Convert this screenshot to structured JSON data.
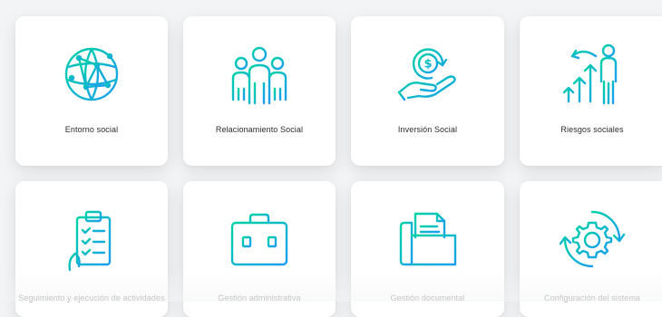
{
  "modules": [
    {
      "id": "entorno",
      "label": "Entorno social",
      "icon": "globe-network-icon"
    },
    {
      "id": "relacionamiento",
      "label": "Relacionamiento Social",
      "icon": "people-group-icon"
    },
    {
      "id": "inversion",
      "label": "Inversión Social",
      "icon": "hand-coin-icon"
    },
    {
      "id": "riesgos",
      "label": "Riesgos sociales",
      "icon": "person-arrows-icon"
    },
    {
      "id": "seguimiento",
      "label": "Seguimiento y ejecución de actividades",
      "icon": "clipboard-checklist-icon"
    },
    {
      "id": "gestion-admin",
      "label": "Gestión administrativa",
      "icon": "briefcase-icon"
    },
    {
      "id": "gestion-doc",
      "label": "Gestión documental",
      "icon": "folder-document-icon"
    },
    {
      "id": "configuracion",
      "label": "Configuración del sistema",
      "icon": "gear-cycle-icon"
    }
  ],
  "colors": {
    "icon_gradient_start": "#00c6a7",
    "icon_gradient_end": "#1aa0f0",
    "card_bg": "#ffffff",
    "page_bg": "#f3f4f5"
  }
}
